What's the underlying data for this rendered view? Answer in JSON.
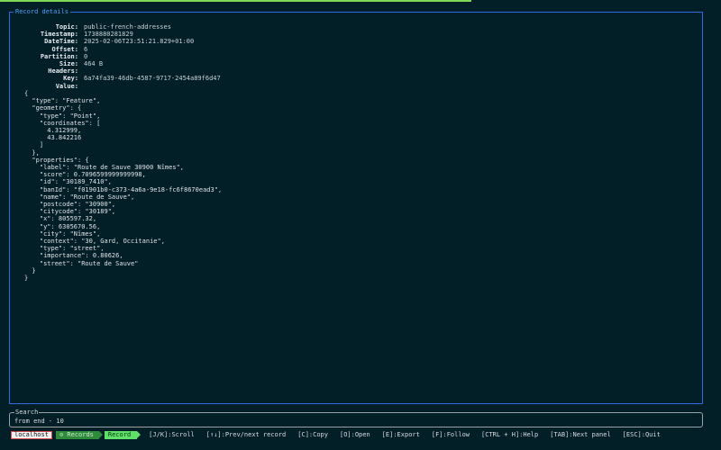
{
  "panel": {
    "title": "Record details"
  },
  "meta": [
    {
      "key": "Topic:",
      "value": "public-french-addresses"
    },
    {
      "key": "Timestamp:",
      "value": "1738880281829"
    },
    {
      "key": "DateTime:",
      "value": "2025-02-06T23:51:21.829+01:00"
    },
    {
      "key": "Offset:",
      "value": "6"
    },
    {
      "key": "Partition:",
      "value": "0"
    },
    {
      "key": "Size:",
      "value": "464 B"
    },
    {
      "key": "Headers:",
      "value": ""
    },
    {
      "key": "Key:",
      "value": "6a74fa39-46db-4587-9717-2454a89f6d47"
    },
    {
      "key": "Value:",
      "value": ""
    }
  ],
  "json_lines": [
    "{",
    "  \"type\": \"Feature\",",
    "  \"geometry\": {",
    "    \"type\": \"Point\",",
    "    \"coordinates\": [",
    "      4.312999,",
    "      43.842216",
    "    ]",
    "  },",
    "  \"properties\": {",
    "    \"label\": \"Route de Sauve 30900 Nîmes\",",
    "    \"score\": 0.7096599999999998,",
    "    \"id\": \"30189_7410\",",
    "    \"banId\": \"f01901b0-c373-4a6a-9e18-fc6f8670ead3\",",
    "    \"name\": \"Route de Sauve\",",
    "    \"postcode\": \"30900\",",
    "    \"citycode\": \"30189\",",
    "    \"x\": 805597.32,",
    "    \"y\": 6305670.56,",
    "    \"city\": \"Nîmes\",",
    "    \"context\": \"30, Gard, Occitanie\",",
    "    \"type\": \"street\",",
    "    \"importance\": 0.80626,",
    "    \"street\": \"Route de Sauve\"",
    "  }",
    "}"
  ],
  "search": {
    "title": "Search",
    "value": "from end - 10"
  },
  "status": {
    "host": "localhost",
    "crumb1": "⊙ Records",
    "crumb2": "Record",
    "help": [
      "[J/K]:Scroll",
      "[↑↓]:Prev/next record",
      "[C]:Copy",
      "[O]:Open",
      "[E]:Export",
      "[F]:Follow",
      "[CTRL + H]:Help",
      "[TAB]:Next panel",
      "[ESC]:Quit"
    ]
  },
  "colors": {
    "panel_border": "#2f6be0",
    "accent_green": "#5ee06a",
    "background": "#021e26"
  }
}
